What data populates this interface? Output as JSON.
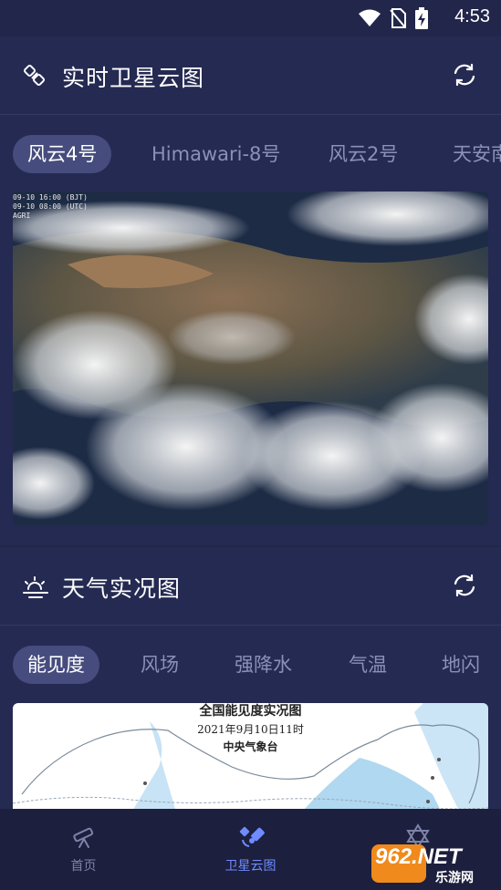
{
  "status": {
    "time": "4:53"
  },
  "satellite": {
    "title": "实时卫星云图",
    "tabs": [
      {
        "label": "风云4号",
        "active": true
      },
      {
        "label": "Himawari-8号",
        "active": false
      },
      {
        "label": "风云2号",
        "active": false
      },
      {
        "label": "天安南",
        "active": false
      }
    ],
    "image_stamp": [
      "09-10 16:00 (BJT)",
      "09-10 08:00 (UTC)",
      "AGRI"
    ]
  },
  "weather": {
    "title": "天气实况图",
    "tabs": [
      {
        "label": "能见度",
        "active": true
      },
      {
        "label": "风场",
        "active": false
      },
      {
        "label": "强降水",
        "active": false
      },
      {
        "label": "气温",
        "active": false
      },
      {
        "label": "地闪",
        "active": false
      }
    ],
    "map": {
      "title": "全国能见度实况图",
      "date": "2021年9月10日11时",
      "source": "中央气象台"
    }
  },
  "bottom_nav": [
    {
      "label": "首页",
      "icon": "telescope-icon",
      "active": false
    },
    {
      "label": "卫星云图",
      "icon": "satellite-icon",
      "active": true
    },
    {
      "label": "",
      "icon": "star-of-david-icon",
      "active": false
    }
  ],
  "watermark": {
    "brand": "962.NET",
    "sub": "乐游网"
  },
  "colors": {
    "background": "#22264a",
    "card": "#252a52",
    "active_tab": "#464c7e",
    "accent": "#6f8bff"
  }
}
